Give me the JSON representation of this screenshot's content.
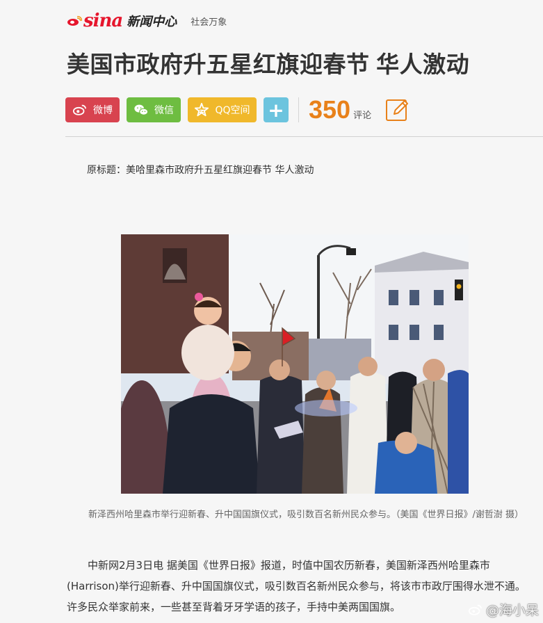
{
  "header": {
    "logo_sina": "sina",
    "logo_news": "新闻中心",
    "channel": "社会万象"
  },
  "article": {
    "title": "美国市政府升五星红旗迎春节 华人激动",
    "original_title": "原标题：美哈里森市政府升五星红旗迎春节 华人激动",
    "caption": "新泽西州哈里森市举行迎新春、升中国国旗仪式，吸引数百名新州民众参与。（美国《世界日报》/谢哲澍 摄）",
    "paragraph": "中新网2月3日电 据美国《世界日报》报道，时值中国农历新春，美国新泽西州哈里森市(Harrison)举行迎新春、升中国国旗仪式，吸引数百名新州民众参与，将该市市政厅围得水泄不通。许多民众举家前来，一些甚至背着牙牙学语的孩子，手持中美两国国旗。"
  },
  "share": {
    "weibo": "微博",
    "wechat": "微信",
    "qzone": "QQ空间",
    "plus": "+",
    "comment_count": "350",
    "comment_label": "评论"
  },
  "watermark": "@海小呆",
  "colors": {
    "weibo": "#d8434f",
    "wechat": "#6ebd41",
    "qzone": "#f0b82b",
    "plus": "#6cc4de",
    "count": "#e8811a",
    "brand": "#e6162d"
  },
  "icons": [
    "sina-eye-icon",
    "weibo-icon",
    "wechat-icon",
    "qzone-star-icon",
    "plus-icon",
    "edit-pencil-icon",
    "weibo-watermark-icon"
  ]
}
